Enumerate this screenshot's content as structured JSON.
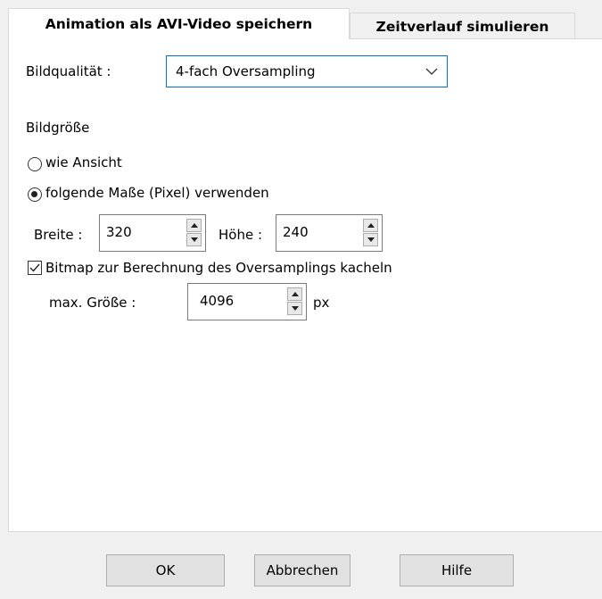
{
  "tabs": {
    "active_label": "Animation als AVI-Video speichern",
    "inactive_label": "Zeitverlauf simulieren"
  },
  "quality": {
    "label": "Bildqualität :",
    "selected": "4-fach Oversampling"
  },
  "size": {
    "heading": "Bildgröße",
    "radio_view": "wie Ansicht",
    "radio_custom": "folgende Maße (Pixel) verwenden",
    "width_label": "Breite :",
    "width_value": "320",
    "height_label": "Höhe :",
    "height_value": "240"
  },
  "tiling": {
    "checkbox_label": "Bitmap zur Berechnung des Oversamplings kacheln",
    "checked": true,
    "max_label": "max. Größe :",
    "max_value": "4096",
    "unit": "px"
  },
  "buttons": {
    "ok": "OK",
    "cancel": "Abbrechen",
    "help": "Hilfe"
  }
}
